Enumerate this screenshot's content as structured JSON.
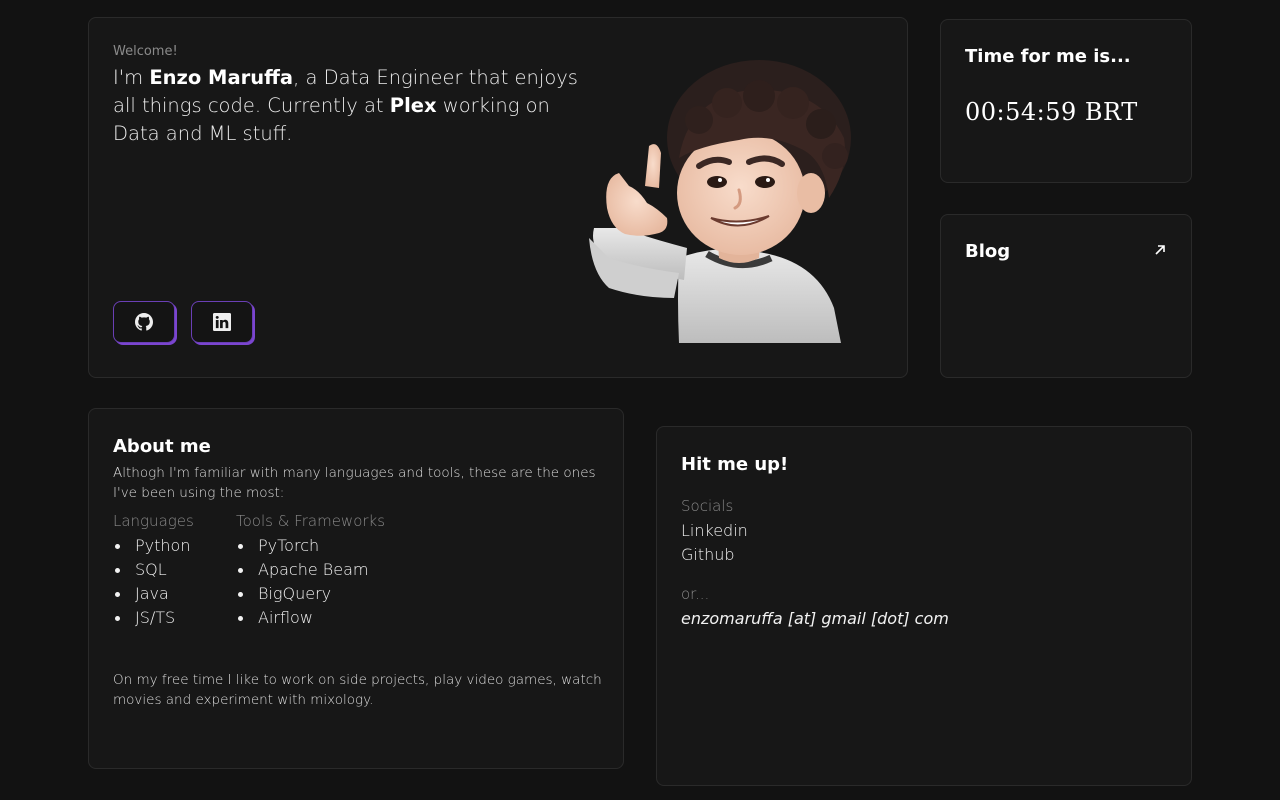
{
  "hero": {
    "welcome": "Welcome!",
    "intro_prefix": "I'm ",
    "name": "Enzo Maruffa",
    "intro_middle": ", a Data Engineer that enjoys all things code. Currently at ",
    "company": "Plex",
    "intro_suffix": " working on Data and ML stuff.",
    "buttons": [
      {
        "icon": "github-icon"
      },
      {
        "icon": "linkedin-icon"
      }
    ],
    "accent_color": "#7b45d0"
  },
  "clock": {
    "title": "Time for me is...",
    "time": "00:54:59 BRT"
  },
  "blog": {
    "title": "Blog",
    "icon": "arrow-up-right-icon"
  },
  "about": {
    "title": "About me",
    "description": "Althogh I'm familiar with many languages and tools, these are the ones I've been using the most:",
    "languages": {
      "heading": "Languages",
      "items": [
        "Python",
        "SQL",
        "Java",
        "JS/TS"
      ]
    },
    "tools": {
      "heading": "Tools & Frameworks",
      "items": [
        "PyTorch",
        "Apache Beam",
        "BigQuery",
        "Airflow"
      ]
    },
    "free_time": "On my free time I like to work on side projects, play video games, watch movies and experiment with mixology."
  },
  "contact": {
    "title": "Hit me up!",
    "socials_heading": "Socials",
    "links": [
      "Linkedin",
      "Github"
    ],
    "or_heading": "or...",
    "email": "enzomaruffa [at] gmail [dot] com"
  }
}
